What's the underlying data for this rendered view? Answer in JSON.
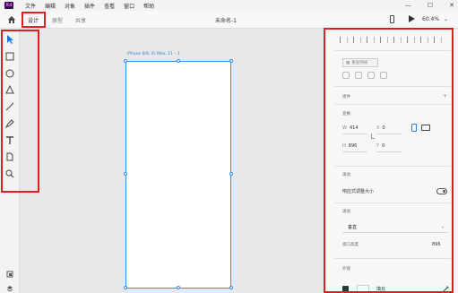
{
  "app": {
    "logo": "Xd"
  },
  "menubar": {
    "items": [
      "文件",
      "编辑",
      "对象",
      "插件",
      "查看",
      "窗口",
      "帮助"
    ],
    "window_controls": [
      "—",
      "☐",
      "✕"
    ]
  },
  "tabbar": {
    "tabs": [
      "设计",
      "原型",
      "共享"
    ],
    "active_tab": "设计",
    "document_title": "未命名-1",
    "zoom": "60.4%",
    "zoom_chevron": "⌄"
  },
  "canvas": {
    "artboard_label": "iPhone 8/8, iO Max, 11 – 1"
  },
  "panel": {
    "repeat_grid": "重复网格",
    "components_label": "组件",
    "plus": "+",
    "transform_label": "变换",
    "width_key": "W",
    "width": "414",
    "x_key": "X",
    "x": "0",
    "height_key": "H",
    "height": "896",
    "y_key": "Y",
    "y": "0",
    "scroll_label": "滚动",
    "responsive_resize": "响应式调整大小",
    "scrolling_label": "滚动",
    "scroll_direction": "垂直",
    "viewport_height_label": "视口高度",
    "viewport_height": "896",
    "appearance_label": "外观",
    "fill_label": "填充"
  },
  "icons": {
    "home": "home-icon",
    "select_tool": "arrow-icon",
    "rectangle_tool": "rectangle-icon",
    "ellipse_tool": "ellipse-icon",
    "polygon_tool": "triangle-icon",
    "line_tool": "line-icon",
    "pen_tool": "pen-icon",
    "text_tool": "text-icon",
    "artboard_tool": "artboard-icon",
    "zoom_tool": "magnifier-icon",
    "device_preview": "phone-icon",
    "play": "play-icon"
  },
  "colors": {
    "highlight": "#e02020",
    "selection": "#3b8ee8",
    "select_tool": "#1a73e8"
  }
}
